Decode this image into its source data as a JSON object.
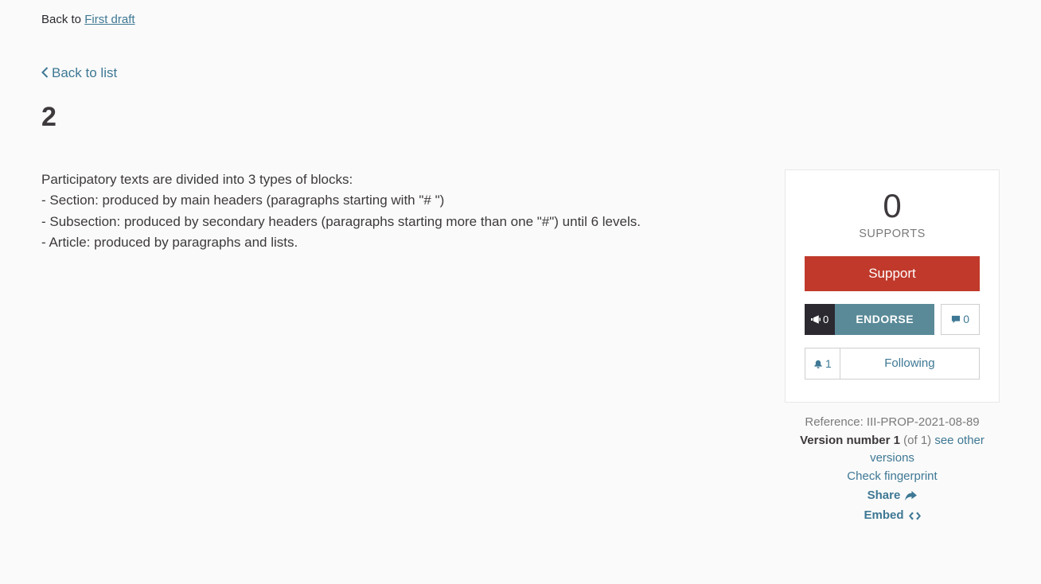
{
  "breadcrumb": {
    "back_to": "Back to ",
    "target": "First draft"
  },
  "back_list": "Back to list",
  "page_title": "2",
  "body": {
    "p1": "Participatory texts are divided into 3 types of blocks:",
    "p2": "- Section: produced by main headers (paragraphs starting with \"# \")",
    "p3": "- Subsection: produced by secondary headers (paragraphs starting more than one \"#\") until 6 levels.",
    "p4": "- Article: produced by paragraphs and lists."
  },
  "sidebar": {
    "supports_count": "0",
    "supports_label": "SUPPORTS",
    "support_button": "Support",
    "endorse_count": "0",
    "endorse_label": "ENDORSE",
    "comments_count": "0",
    "follow_count": "1",
    "follow_label": "Following"
  },
  "meta": {
    "reference_label": "Reference: ",
    "reference_value": "III-PROP-2021-08-89",
    "version_label": "Version number 1",
    "version_of": " (of 1) ",
    "see_other": "see other versions",
    "check_fingerprint": "Check fingerprint",
    "share": "Share",
    "embed": "Embed"
  }
}
